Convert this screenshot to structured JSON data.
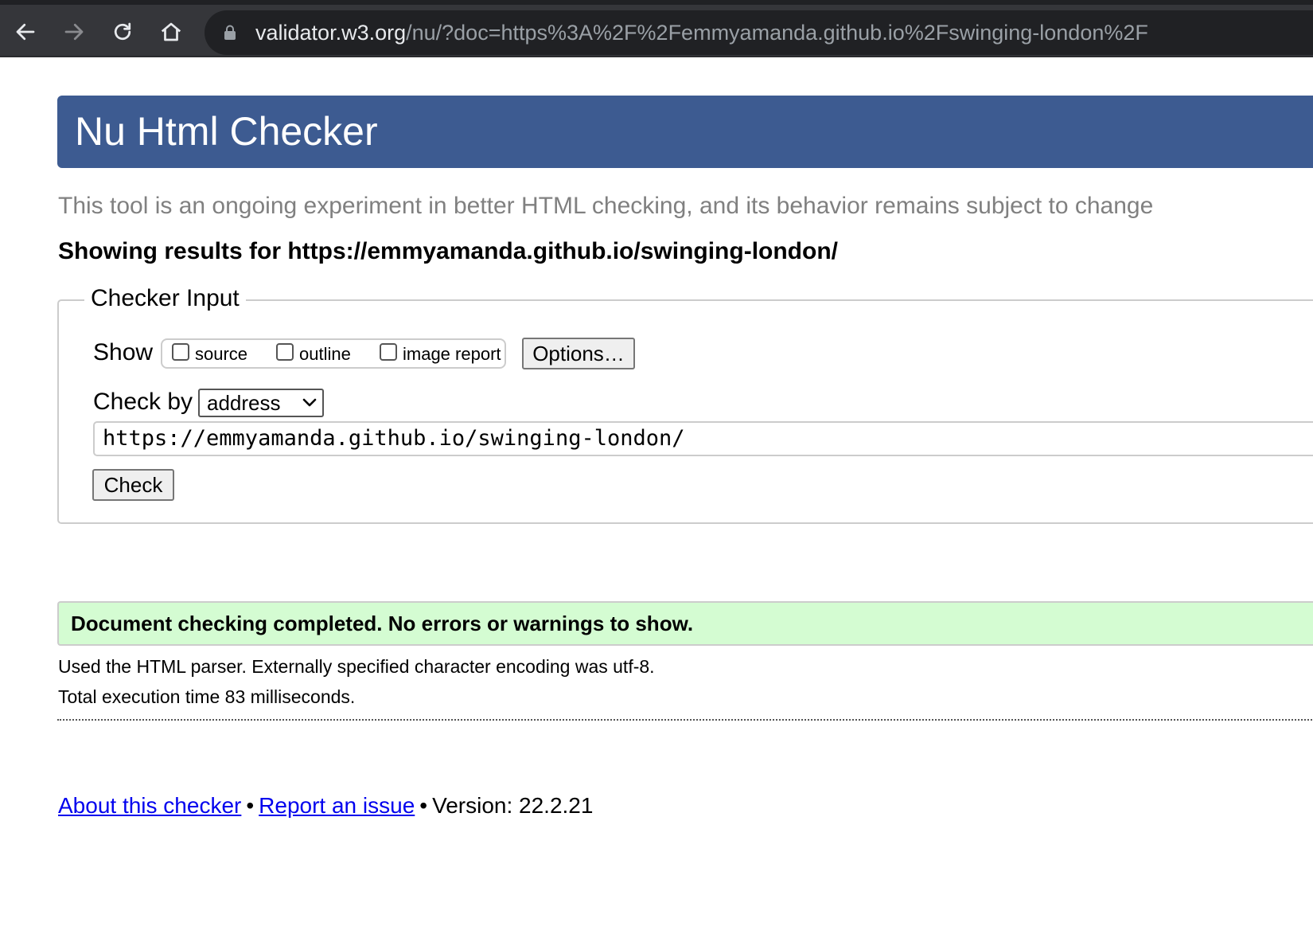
{
  "browser": {
    "url_host": "validator.w3.org",
    "url_path": "/nu/?doc=https%3A%2F%2Femmyamanda.github.io%2Fswinging-london%2F"
  },
  "page": {
    "title": "Nu Html Checker",
    "subtitle": "This tool is an ongoing experiment in better HTML checking, and its behavior remains subject to change",
    "showing_results": "Showing results for https://emmyamanda.github.io/swinging-london/"
  },
  "checker_input": {
    "legend": "Checker Input",
    "show_label": "Show",
    "options": [
      {
        "label": "source",
        "checked": false
      },
      {
        "label": "outline",
        "checked": false
      },
      {
        "label": "image report",
        "checked": false
      }
    ],
    "options_button": "Options…",
    "check_by_label": "Check by",
    "check_by_value": "address",
    "address_value": "https://emmyamanda.github.io/swinging-london/",
    "check_button": "Check"
  },
  "result": {
    "message": "Document checking completed. No errors or warnings to show.",
    "parser_info": "Used the HTML parser. Externally specified character encoding was utf-8.",
    "execution_time": "Total execution time 83 milliseconds."
  },
  "footer": {
    "about_link": "About this checker",
    "report_link": "Report an issue",
    "separator": "•",
    "version": "Version: 22.2.21"
  }
}
